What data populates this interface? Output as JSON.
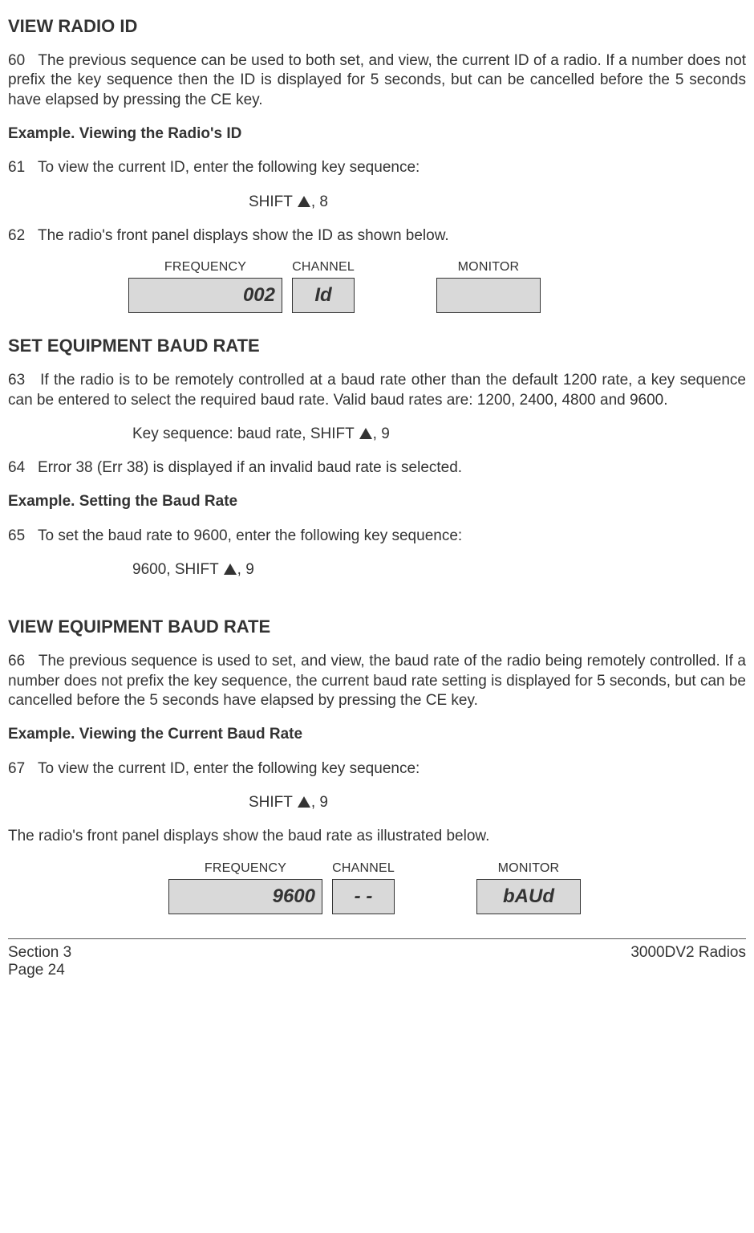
{
  "section1": {
    "heading": "VIEW RADIO ID",
    "p60_a": "60",
    "p60_b": "The previous sequence can be used to both set, and view, the current ID of a radio. If a number does not prefix the key sequence then the ID is displayed for 5 seconds, but can be cancelled before the 5 seconds have elapsed by pressing the CE key.",
    "example1": "Example. Viewing the Radio's ID",
    "p61_a": "61",
    "p61_b": "To view the current ID, enter the following key sequence:",
    "seq1_pre": "SHIFT ",
    "seq1_post": ", 8",
    "p62_a": "62",
    "p62_b": "The radio's front panel displays show the ID as shown below."
  },
  "display1": {
    "freq_label": "FREQUENCY",
    "chan_label": "CHANNEL",
    "mon_label": "MONITOR",
    "freq_val": "002",
    "chan_val": "Id",
    "mon_val": ""
  },
  "section2": {
    "heading": "SET EQUIPMENT BAUD RATE",
    "p63_a": "63",
    "p63_b": "If the radio is to be remotely controlled at a baud rate other than the default 1200 rate, a key sequence can be entered to select the required baud rate. Valid baud rates are: 1200, 2400, 4800 and 9600.",
    "seq2_label": "Key sequence:  baud rate, SHIFT ",
    "seq2_post": ", 9",
    "p64_a": "64",
    "p64_b": "Error 38 (Err 38)  is displayed if an invalid baud rate is selected.",
    "example2": "Example. Setting the Baud Rate",
    "p65_a": "65",
    "p65_b": "To set the baud rate to 9600, enter the following key sequence:",
    "seq3_pre": "9600, SHIFT ",
    "seq3_post": ", 9"
  },
  "section3": {
    "heading": "VIEW EQUIPMENT BAUD RATE",
    "p66_a": "66",
    "p66_b": "The previous sequence is used to set, and view, the baud rate of the radio being remotely controlled.  If a number does not prefix the key sequence, the current baud rate setting is displayed for 5 seconds, but can be cancelled before the 5 seconds have elapsed by pressing the CE key.",
    "example3": "Example. Viewing the Current Baud Rate",
    "p67_a": "67",
    "p67_b": "To view the current ID, enter the following key sequence:",
    "seq4_pre": "SHIFT ",
    "seq4_post": ", 9",
    "p_after": "The radio's front panel displays show the baud rate as illustrated below."
  },
  "display2": {
    "freq_label": "FREQUENCY",
    "chan_label": "CHANNEL",
    "mon_label": "MONITOR",
    "freq_val": "9600",
    "chan_val": "- -",
    "mon_val": "bAUd"
  },
  "footer": {
    "left1": "Section 3",
    "left2": "Page 24",
    "right": "3000DV2 Radios"
  }
}
